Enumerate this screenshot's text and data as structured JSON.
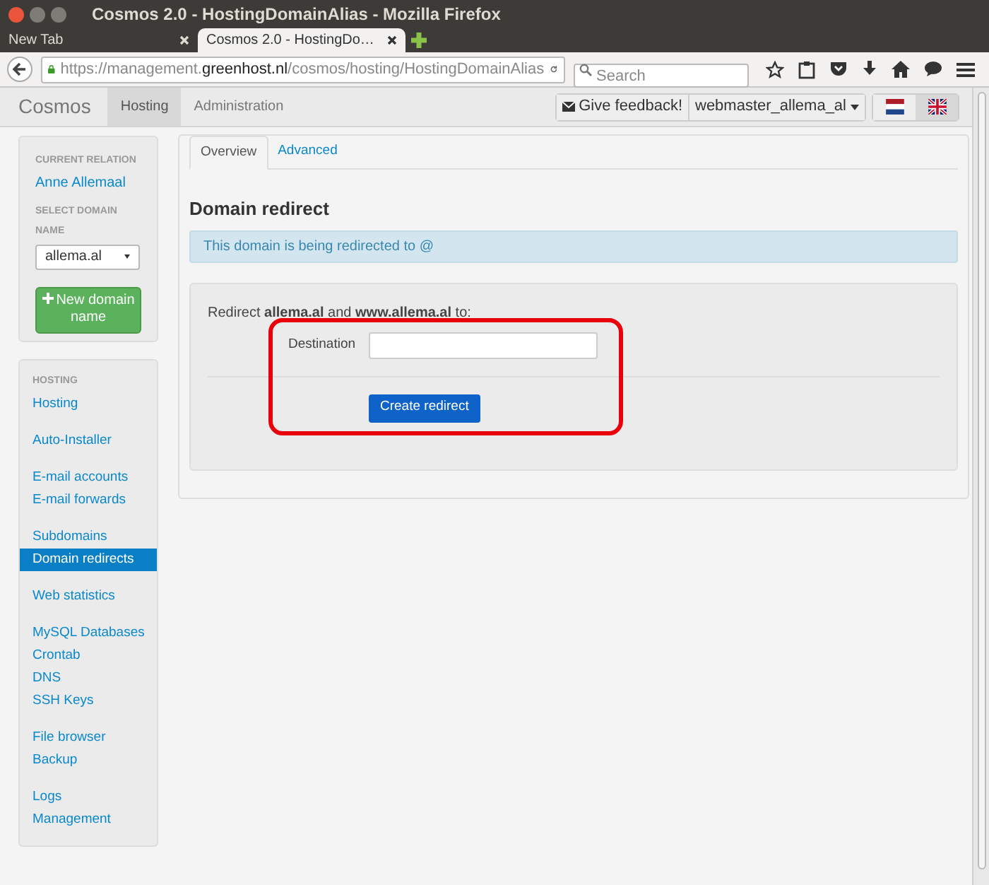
{
  "window": {
    "title": "Cosmos 2.0 - HostingDomainAlias - Mozilla Firefox"
  },
  "browser_tabs": [
    {
      "label": "New Tab",
      "selected": false
    },
    {
      "label": "Cosmos 2.0 - HostingDo…",
      "selected": true
    }
  ],
  "address_bar": {
    "url_prefix": "https://management.",
    "url_domain": "greenhost.nl",
    "url_path": "/cosmos/hosting/HostingDomainAlias"
  },
  "search": {
    "placeholder": "Search"
  },
  "app_nav": {
    "brand": "Cosmos",
    "items": [
      {
        "label": "Hosting",
        "selected": true
      },
      {
        "label": "Administration",
        "selected": false
      }
    ],
    "feedback": "Give feedback!",
    "user": "webmaster_allema_al",
    "languages": [
      {
        "kind": "dutch",
        "selected": false
      },
      {
        "kind": "british",
        "selected": true
      }
    ]
  },
  "relation_panel": {
    "relation_heading": "CURRENT RELATION",
    "relation": "Anne Allemaal",
    "domain_heading": "SELECT DOMAIN NAME",
    "domain": "allema.al",
    "new_button": "New domain name"
  },
  "menu": {
    "heading": "HOSTING",
    "groups": [
      [
        {
          "label": "Hosting",
          "selected": false
        }
      ],
      [
        {
          "label": "Auto-Installer",
          "selected": false
        }
      ],
      [
        {
          "label": "E-mail accounts",
          "selected": false
        },
        {
          "label": "E-mail forwards",
          "selected": false
        }
      ],
      [
        {
          "label": "Subdomains",
          "selected": false
        },
        {
          "label": "Domain redirects",
          "selected": true
        }
      ],
      [
        {
          "label": "Web statistics",
          "selected": false
        }
      ],
      [
        {
          "label": "MySQL Databases",
          "selected": false
        },
        {
          "label": "Crontab",
          "selected": false
        },
        {
          "label": "DNS",
          "selected": false
        },
        {
          "label": "SSH Keys",
          "selected": false
        }
      ],
      [
        {
          "label": "File browser",
          "selected": false
        },
        {
          "label": "Backup",
          "selected": false
        }
      ],
      [
        {
          "label": "Logs",
          "selected": false
        },
        {
          "label": "Management",
          "selected": false
        }
      ]
    ]
  },
  "content_tabs": [
    {
      "label": "Overview",
      "selected": true
    },
    {
      "label": "Advanced",
      "selected": false
    }
  ],
  "heading": "Domain redirect",
  "alert": "This domain is being redirected to @",
  "form": {
    "intro": "Redirect **allema.al** and **www.allema.al** to:",
    "destination_label": "Destination",
    "submit": "Create redirect"
  }
}
